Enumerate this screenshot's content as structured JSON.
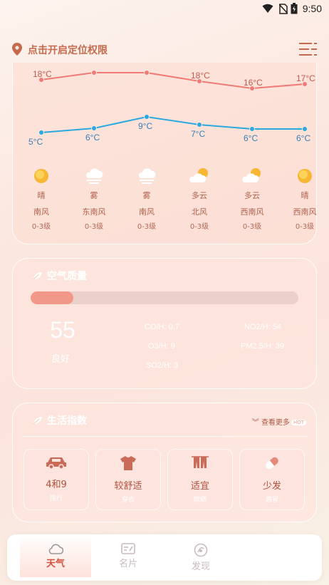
{
  "status": {
    "time": "9:50"
  },
  "header": {
    "location_prompt": "点击开启定位权限"
  },
  "forecast": {
    "days": [
      {
        "high": "18°C",
        "low": "5°C",
        "condition": "晴",
        "wind": "南风",
        "level": "0-3级",
        "icon": "sun-icon"
      },
      {
        "high": "",
        "low": "6°C",
        "condition": "雾",
        "wind": "东南风",
        "level": "0-3级",
        "icon": "fog-icon"
      },
      {
        "high": "",
        "low": "9°C",
        "condition": "雾",
        "wind": "南风",
        "level": "0-3级",
        "icon": "fog-icon"
      },
      {
        "high": "18°C",
        "low": "7°C",
        "condition": "多云",
        "wind": "北风",
        "level": "0-3级",
        "icon": "partly-cloudy-icon"
      },
      {
        "high": "16°C",
        "low": "6°C",
        "condition": "多云",
        "wind": "西南风",
        "level": "0-3级",
        "icon": "partly-cloudy-icon"
      },
      {
        "high": "17°C",
        "low": "6°C",
        "condition": "晴",
        "wind": "西南风",
        "level": "0-3级",
        "icon": "sun-icon"
      }
    ]
  },
  "air_quality": {
    "title": "空气质量",
    "aqi": "55",
    "aqi_fraction": 0.16,
    "level": "良好",
    "co": "CO/H: 0.7",
    "no2": "NO2/H: 54",
    "o3": "O3/H: 9",
    "pm25": "PM2.5/H: 39",
    "so2": "SO2/H: 3"
  },
  "life_index": {
    "title": "生活指数",
    "more": "查看更多",
    "more_badge": "HOT",
    "items": [
      {
        "value": "4和9",
        "name": "限行",
        "icon": "car-icon"
      },
      {
        "value": "较舒适",
        "name": "穿衣",
        "icon": "clothing-icon"
      },
      {
        "value": "适宜",
        "name": "晾晒",
        "icon": "drying-icon"
      },
      {
        "value": "少发",
        "name": "感冒",
        "icon": "pill-icon"
      }
    ]
  },
  "tabs": [
    {
      "label": "天气",
      "icon": "cloud-icon",
      "active": true
    },
    {
      "label": "名片",
      "icon": "card-icon",
      "active": false
    },
    {
      "label": "发现",
      "icon": "discover-icon",
      "active": false
    }
  ],
  "colors": {
    "accent": "#d0523e",
    "high_line": "#f07a76",
    "low_line": "#2aa8e0"
  }
}
